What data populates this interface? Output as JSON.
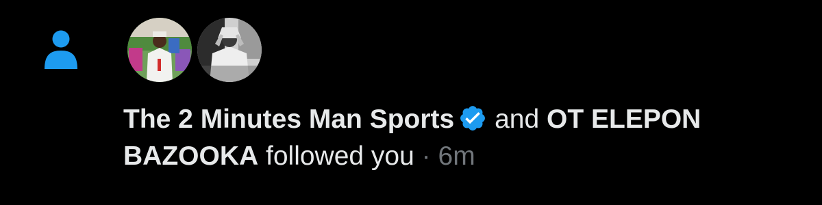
{
  "notification": {
    "type_icon": "person-icon",
    "avatars": [
      {
        "name": "The 2 Minutes Man Sports",
        "icon": "avatar-photo"
      },
      {
        "name": "OT ELEPON BAZOOKA",
        "icon": "avatar-photo"
      }
    ],
    "actor_1": "The 2 Minutes Man Sports",
    "actor_1_verified": true,
    "conjunction": "and",
    "actor_2": "OT ELEPON BAZOOKA",
    "action": "followed you",
    "separator": "·",
    "time": "6m"
  },
  "colors": {
    "background": "#000000",
    "text": "#e7e9ea",
    "muted": "#71767b",
    "accent": "#1d9bf0"
  }
}
